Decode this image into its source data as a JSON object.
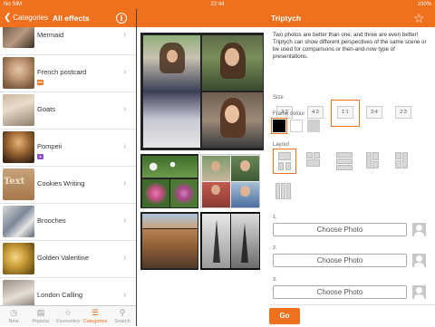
{
  "status": {
    "carrier": "No SIM",
    "time": "22:44",
    "battery": "100%"
  },
  "nav": {
    "back_label": "Categories",
    "title": "All effects",
    "info_glyph": "i",
    "detail_title": "Triptych",
    "star_glyph": "☆"
  },
  "effects": [
    {
      "name": "Mermaid",
      "badge": null
    },
    {
      "name": "French postcard",
      "badge": "HD"
    },
    {
      "name": "Goats",
      "badge": null
    },
    {
      "name": "Pompeii",
      "badge": "person"
    },
    {
      "name": "Cookies Writing",
      "badge": null
    },
    {
      "name": "Brooches",
      "badge": null
    },
    {
      "name": "Golden Valentine",
      "badge": null
    },
    {
      "name": "London Calling",
      "badge": null
    }
  ],
  "tabs": [
    {
      "label": "New",
      "icon": "clock-icon",
      "active": false
    },
    {
      "label": "Popular",
      "icon": "list-icon",
      "active": false
    },
    {
      "label": "Favourites",
      "icon": "star-icon",
      "active": false
    },
    {
      "label": "Categories",
      "icon": "menu-icon",
      "active": true
    },
    {
      "label": "Search",
      "icon": "search-icon",
      "active": false
    }
  ],
  "settings": {
    "description": "Two photos are better than one, and three are even better! Triptych can show different perspectives of the same scene or be used for comparisons or then-and-now type of presentations.",
    "size_label": "Size",
    "sizes": [
      "3:2",
      "4:3",
      "1:1",
      "3:4",
      "2:3"
    ],
    "selected_size": "1:1",
    "frame_label": "Frame colour",
    "frame_colours": [
      "#000000",
      "#ffffff",
      "#cfcfcf"
    ],
    "layout_label": "Layout",
    "photo_slots": [
      {
        "number": "1.",
        "button": "Choose Photo"
      },
      {
        "number": "2.",
        "button": "Choose Photo"
      },
      {
        "number": "3.",
        "button": "Choose Photo"
      }
    ]
  },
  "go_label": "Go",
  "colors": {
    "accent": "#f0701e",
    "divider": "#444444"
  }
}
